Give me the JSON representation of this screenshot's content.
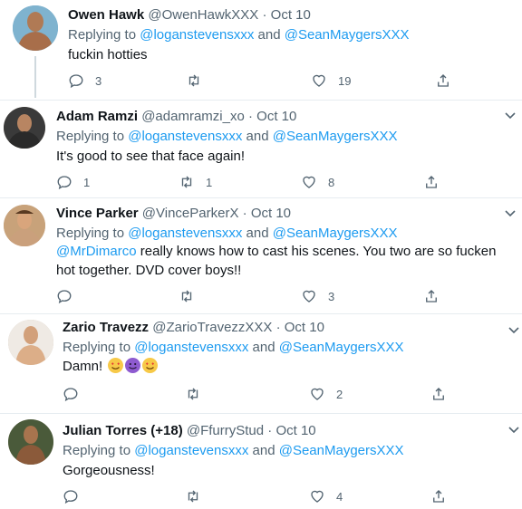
{
  "tweets": [
    {
      "name": "Owen Hawk",
      "handle": "@OwenHawkXXX",
      "dot": "·",
      "date": "Oct 10",
      "replying_prefix": "Replying to ",
      "mention1": "@loganstevensxxx",
      "and": " and ",
      "mention2": "@SeanMaygersXXX",
      "text": "fuckin hotties",
      "replies": "3",
      "retweets": "",
      "likes": "19"
    },
    {
      "name": "Adam Ramzi",
      "handle": "@adamramzi_xo",
      "dot": "·",
      "date": "Oct 10",
      "replying_prefix": "Replying to ",
      "mention1": "@loganstevensxxx",
      "and": " and ",
      "mention2": "@SeanMaygersXXX",
      "text": "It's good to see that face again!",
      "replies": "1",
      "retweets": "1",
      "likes": "8"
    },
    {
      "name": "Vince Parker",
      "handle": "@VinceParkerX",
      "dot": "·",
      "date": "Oct 10",
      "replying_prefix": "Replying to ",
      "mention1": "@loganstevensxxx",
      "and": " and ",
      "mention2": "@SeanMaygersXXX",
      "text_mention": "@MrDimarco",
      "text": " really knows how to cast his scenes. You two are so fucken hot together. DVD cover boys!!",
      "replies": "",
      "retweets": "",
      "likes": "3"
    },
    {
      "name": "Zario Travezz",
      "handle": "@ZarioTravezzXXX",
      "dot": "·",
      "date": "Oct 10",
      "replying_prefix": "Replying to ",
      "mention1": "@loganstevensxxx",
      "and": " and ",
      "mention2": "@SeanMaygersXXX",
      "text": "Damn!",
      "emojis": [
        "smiling-face-with-heart-eyes",
        "smiling-face-with-horns",
        "smiling-face-with-heart-eyes"
      ],
      "replies": "",
      "retweets": "",
      "likes": "2"
    },
    {
      "name": "Julian Torres (+18)",
      "handle": "@FfurryStud",
      "dot": "·",
      "date": "Oct 10",
      "replying_prefix": "Replying to ",
      "mention1": "@loganstevensxxx",
      "and": " and ",
      "mention2": "@SeanMaygersXXX",
      "text": "Gorgeousness!",
      "replies": "",
      "retweets": "",
      "likes": "4"
    }
  ],
  "colors": {
    "link": "#1d9bf0",
    "muted": "#536471",
    "text": "#0f1419",
    "separator": "#e6ecf0"
  },
  "icons": [
    "reply-icon",
    "retweet-icon",
    "like-icon",
    "share-icon",
    "chevron-down-icon"
  ]
}
